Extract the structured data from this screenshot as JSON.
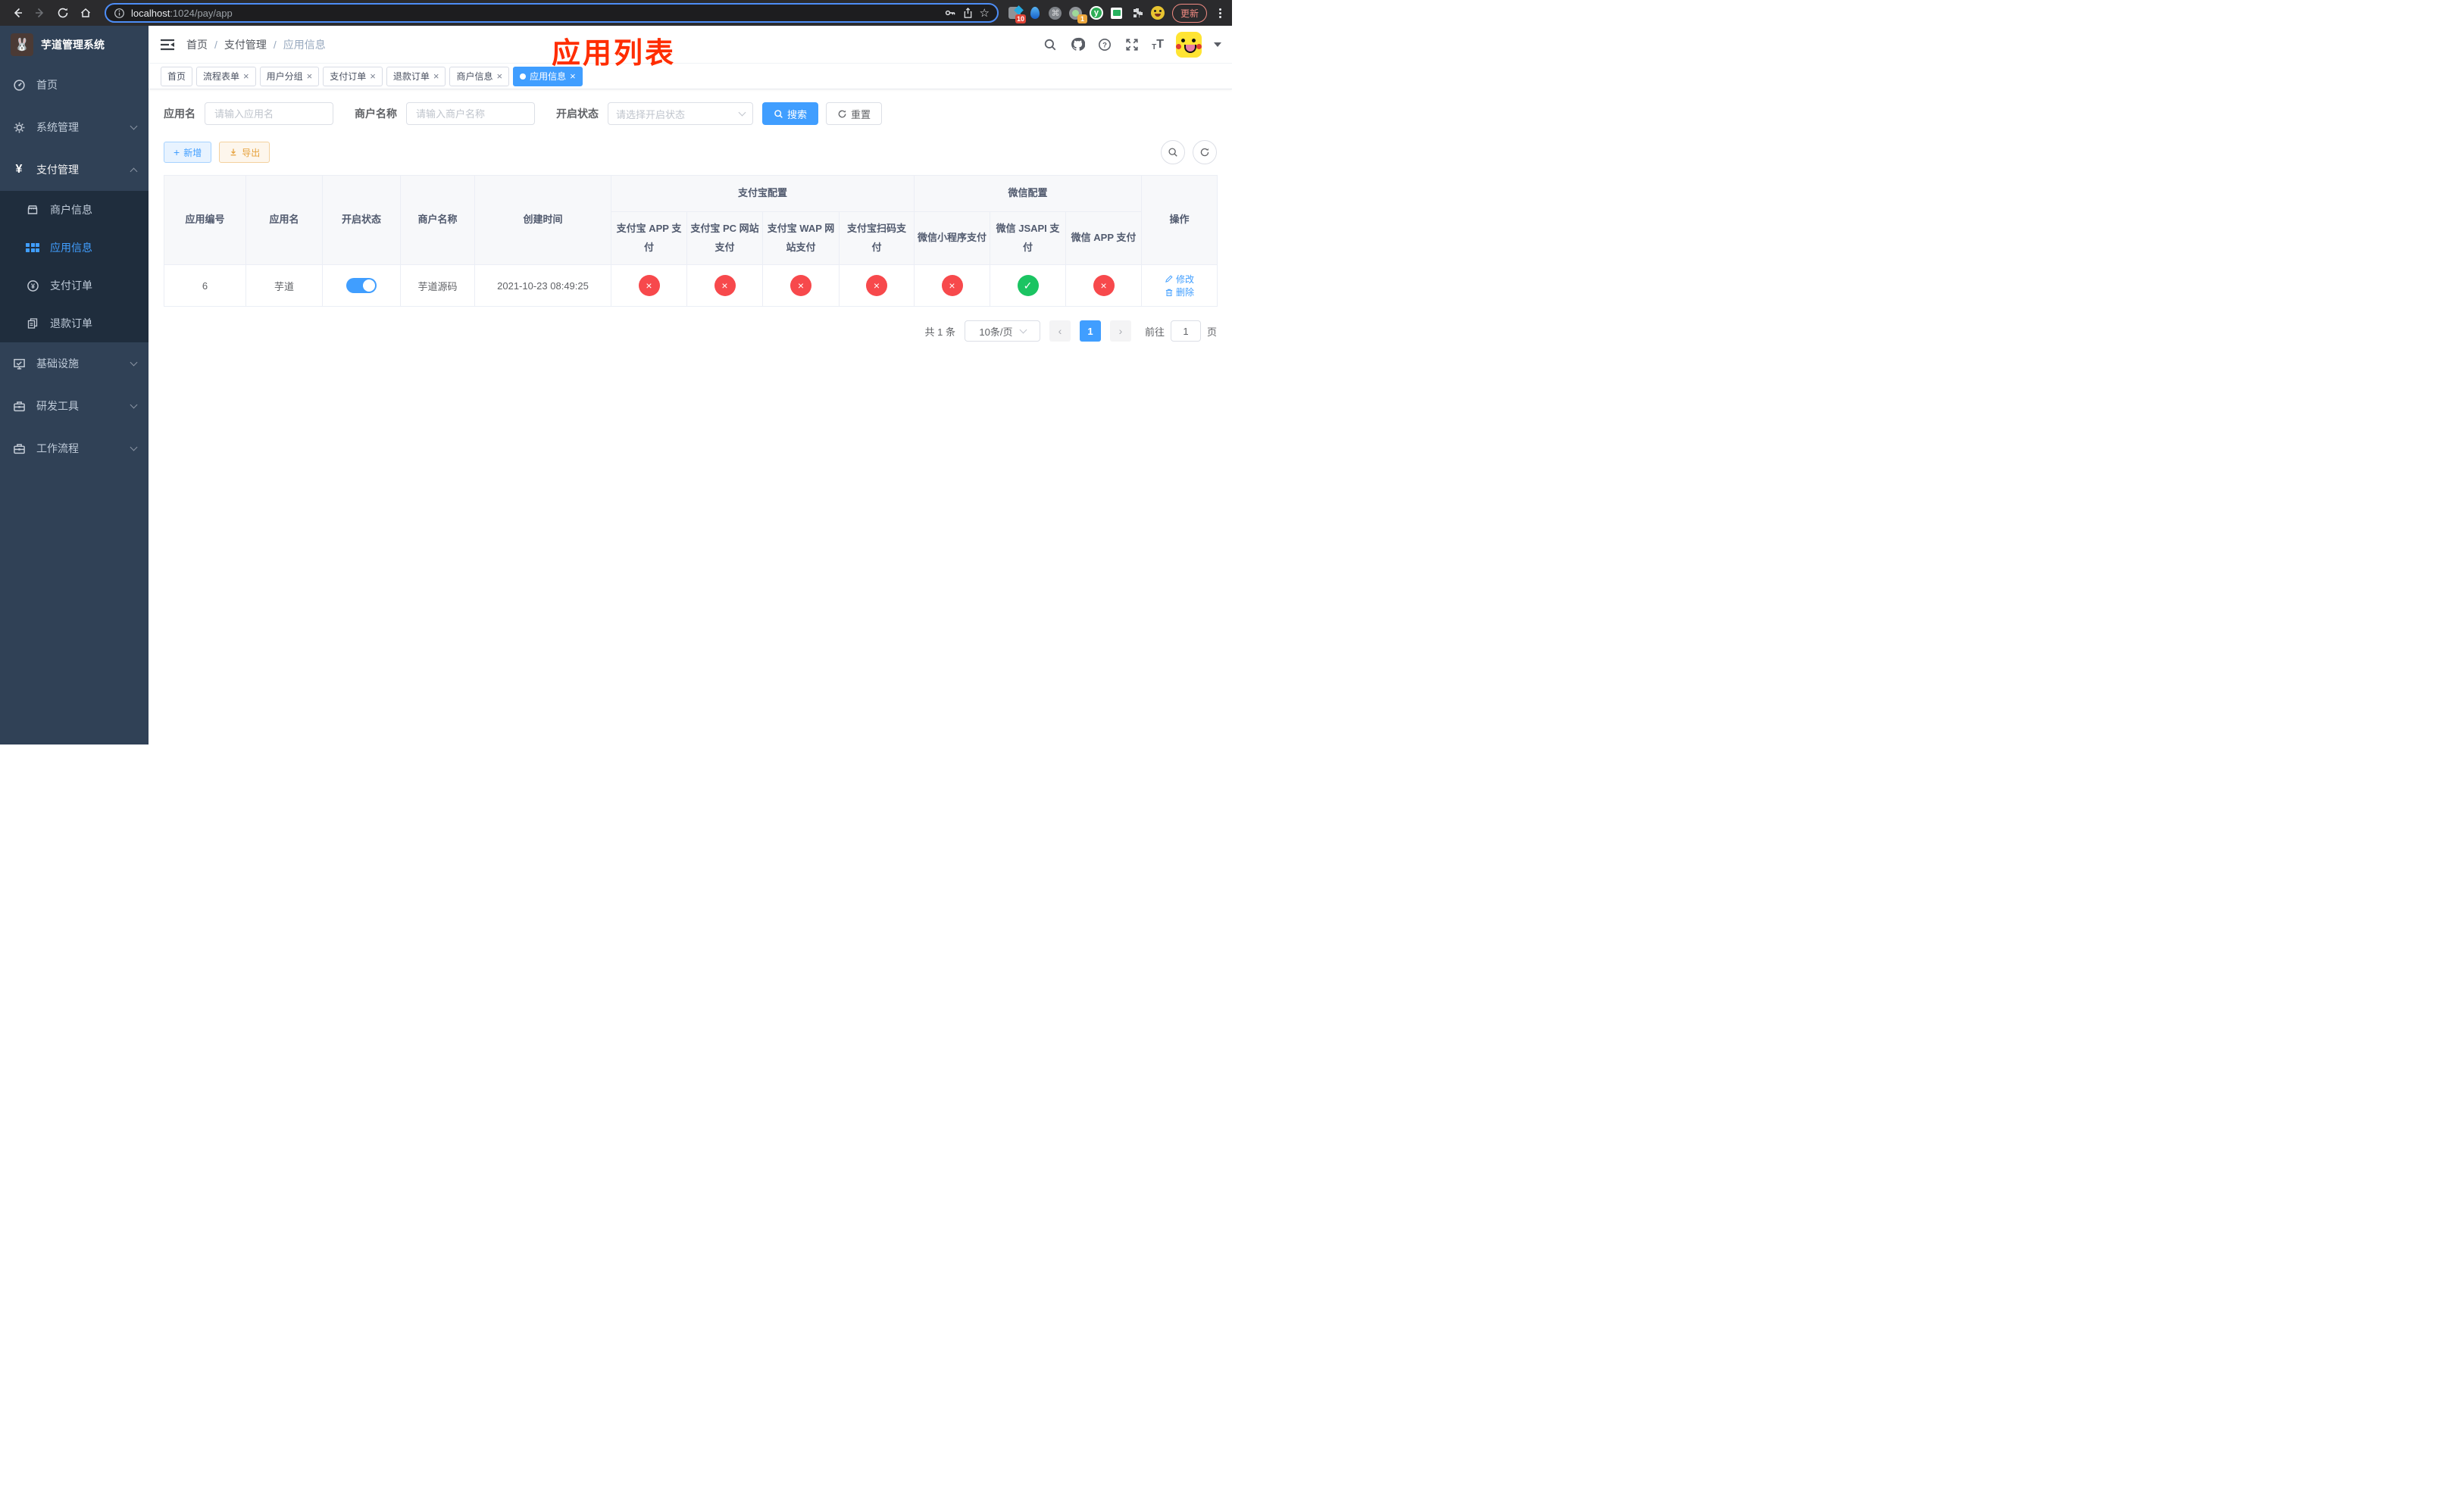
{
  "browser": {
    "url_host": "localhost",
    "url_rest": ":1024/pay/app",
    "update_label": "更新",
    "extension_badge_blocker": "10",
    "extension_badge_proxy": "1"
  },
  "sidebar": {
    "title": "芋道管理系统",
    "items": [
      {
        "label": "首页"
      },
      {
        "label": "系统管理"
      },
      {
        "label": "支付管理"
      },
      {
        "label": "商户信息"
      },
      {
        "label": "应用信息"
      },
      {
        "label": "支付订单"
      },
      {
        "label": "退款订单"
      },
      {
        "label": "基础设施"
      },
      {
        "label": "研发工具"
      },
      {
        "label": "工作流程"
      }
    ]
  },
  "navbar": {
    "breadcrumb": [
      {
        "label": "首页"
      },
      {
        "label": "支付管理"
      },
      {
        "label": "应用信息"
      }
    ],
    "annotation": "应用列表"
  },
  "tags": [
    {
      "label": "首页",
      "closable": false,
      "active": false
    },
    {
      "label": "流程表单",
      "closable": true,
      "active": false
    },
    {
      "label": "用户分组",
      "closable": true,
      "active": false
    },
    {
      "label": "支付订单",
      "closable": true,
      "active": false
    },
    {
      "label": "退款订单",
      "closable": true,
      "active": false
    },
    {
      "label": "商户信息",
      "closable": true,
      "active": false
    },
    {
      "label": "应用信息",
      "closable": true,
      "active": true
    }
  ],
  "filters": {
    "app_name_label": "应用名",
    "app_name_placeholder": "请输入应用名",
    "merchant_label": "商户名称",
    "merchant_placeholder": "请输入商户名称",
    "status_label": "开启状态",
    "status_placeholder": "请选择开启状态",
    "search_label": "搜索",
    "reset_label": "重置"
  },
  "toolbar": {
    "add_label": "新增",
    "export_label": "导出"
  },
  "table": {
    "header": {
      "col_id": "应用编号",
      "col_name": "应用名",
      "col_status": "开启状态",
      "col_merchant": "商户名称",
      "col_created": "创建时间",
      "group_alipay": "支付宝配置",
      "group_wechat": "微信配置",
      "alipay_cols": [
        "支付宝 APP 支付",
        "支付宝 PC 网站支付",
        "支付宝 WAP 网站支付",
        "支付宝扫码支付"
      ],
      "wechat_cols": [
        "微信小程序支付",
        "微信 JSAPI 支付",
        "微信 APP 支付"
      ],
      "col_actions": "操作"
    },
    "row": {
      "id": "6",
      "name": "芋道",
      "enabled": true,
      "merchant": "芋道源码",
      "created": "2021-10-23 08:49:25",
      "channels": [
        false,
        false,
        false,
        false,
        false,
        true,
        false
      ]
    },
    "actions": {
      "edit": "修改",
      "delete": "删除"
    }
  },
  "pagination": {
    "total": "共 1 条",
    "page_size": "10条/页",
    "current_page": "1",
    "goto_label": "前往",
    "goto_value": "1",
    "page_unit": "页"
  },
  "colors": {
    "accent": "#409eff",
    "danger": "#f7494c",
    "success": "#1bc462",
    "warning": "#e6a23c",
    "annotation": "#ff2d00",
    "sidebar-bg": "#304156",
    "submenu-bg": "#1f2d3d"
  }
}
